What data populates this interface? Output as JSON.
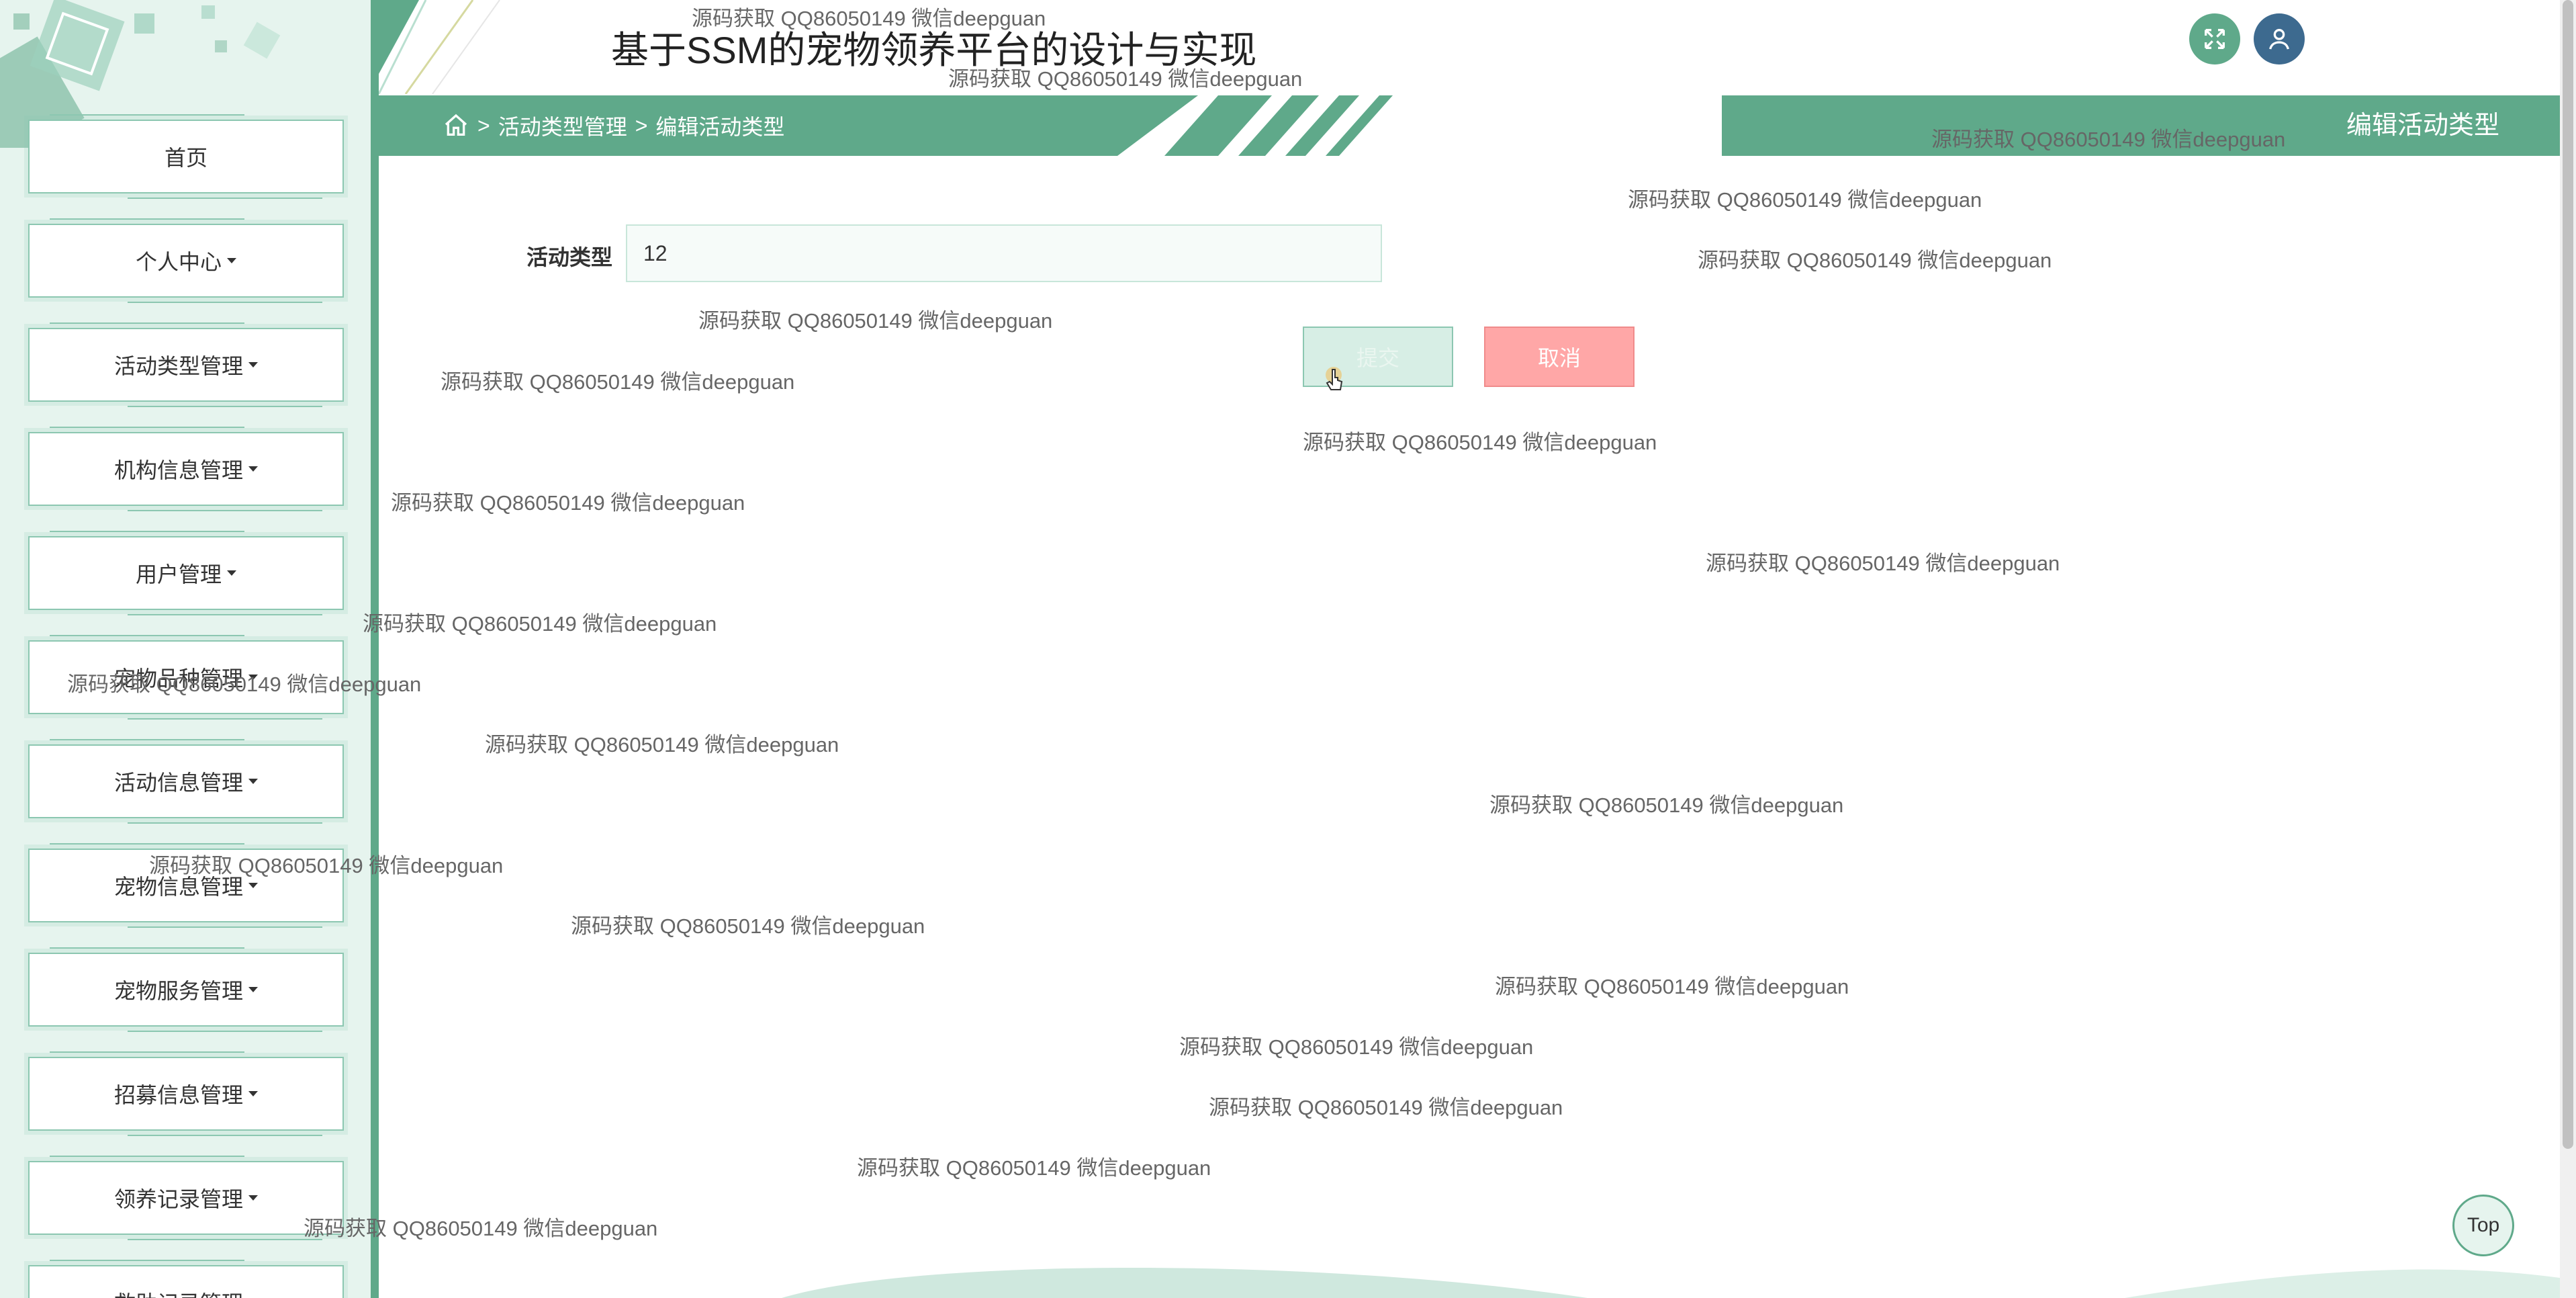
{
  "app": {
    "title": "基于SSM的宠物领养平台的设计与实现"
  },
  "header": {
    "fullscreen_icon": "expand-icon",
    "user_icon": "user-icon"
  },
  "sidebar": {
    "items": [
      {
        "label": "首页",
        "dropdown": false
      },
      {
        "label": "个人中心",
        "dropdown": true
      },
      {
        "label": "活动类型管理",
        "dropdown": true
      },
      {
        "label": "机构信息管理",
        "dropdown": true
      },
      {
        "label": "用户管理",
        "dropdown": true
      },
      {
        "label": "宠物品种管理",
        "dropdown": true
      },
      {
        "label": "活动信息管理",
        "dropdown": true
      },
      {
        "label": "宠物信息管理",
        "dropdown": true
      },
      {
        "label": "宠物服务管理",
        "dropdown": true
      },
      {
        "label": "招募信息管理",
        "dropdown": true
      },
      {
        "label": "领养记录管理",
        "dropdown": true
      },
      {
        "label": "救助记录管理",
        "dropdown": true
      }
    ]
  },
  "breadcrumb": {
    "home_icon": "home-icon",
    "items": [
      "活动类型管理",
      "编辑活动类型"
    ],
    "separator": ">"
  },
  "page_tag": "编辑活动类型",
  "form": {
    "field_label": "活动类型",
    "field_value": "12",
    "submit_label": "提交",
    "cancel_label": "取消"
  },
  "watermark_text": "源码获取 QQ86050149 微信deepguan",
  "top_button": "Top",
  "colors": {
    "primary": "#5fa98a",
    "sidebar_bg": "#e6f4ee",
    "cancel": "#ffa7a7",
    "user_button": "#3d6a8f"
  }
}
